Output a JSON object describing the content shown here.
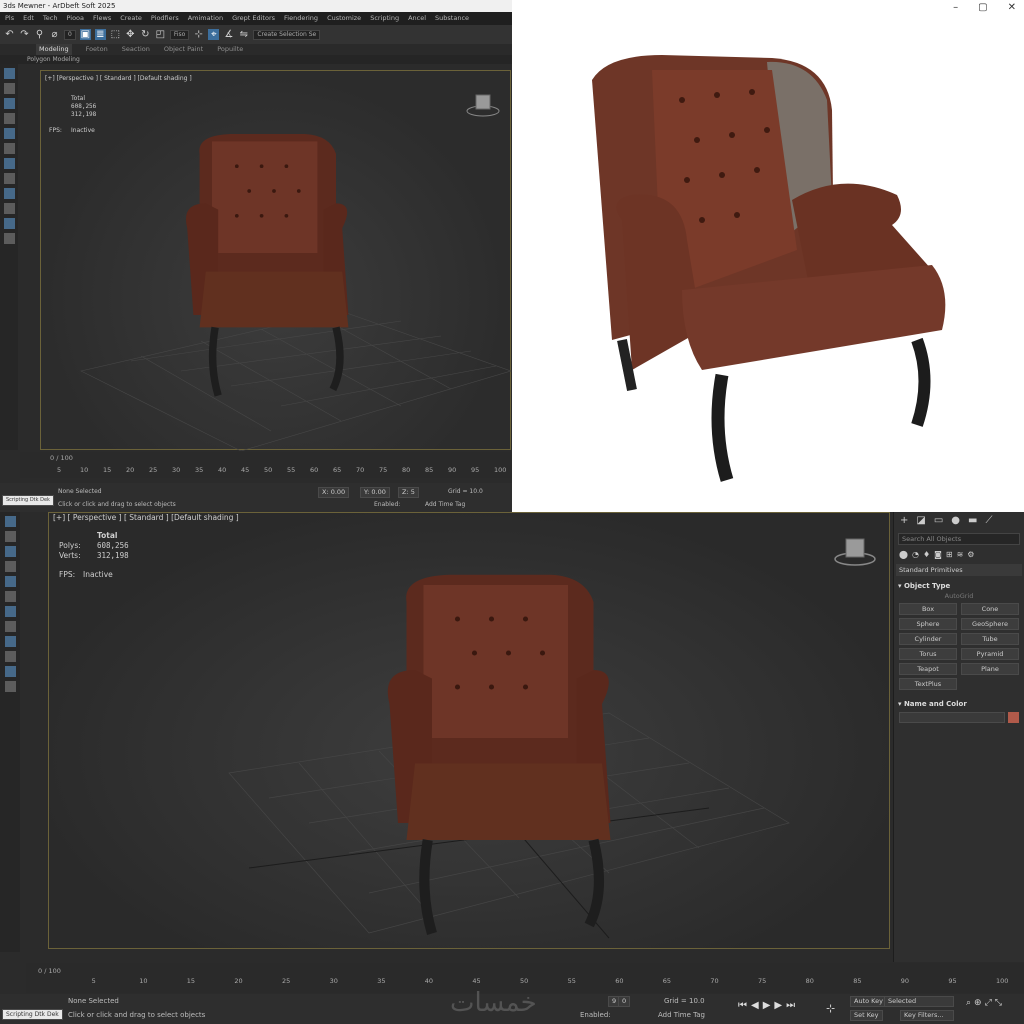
{
  "colors": {
    "viewport_border": "#6b6239",
    "accent": "#3c6e9c",
    "leather": "#6b3224",
    "background": "#2b2b2b"
  },
  "top_app": {
    "title": "3ds Mewner - ArDbeft Soft 2025",
    "menu": [
      "Pls",
      "Edt",
      "Tech",
      "Piooa",
      "Flews",
      "Create",
      "Piodfiers",
      "Amimation",
      "Grept Editors",
      "Fiendering",
      "Customize",
      "Scripting",
      "Ancel",
      "Substance"
    ],
    "toolbar_dropdown_1": "0",
    "toolbar_dropdown_2": "Fiso",
    "toolbar_dropdown_3": "Create Selection Se",
    "ribbon_tabs": [
      "Modeling",
      "Foeton",
      "Seaction",
      "Object Paint",
      "Popuilte"
    ],
    "subtab": "Polygon Modeling",
    "viewport_label": "[+] [Perspective ] [ Standard ] [Default shading ]",
    "stats_total": "Total",
    "stats_polys": "608,256",
    "stats_verts": "312,198",
    "fps_label": "FPS:",
    "fps_value": "Inactive",
    "frame_counter": "0 / 100",
    "ticks": [
      "5",
      "10",
      "15",
      "20",
      "25",
      "30",
      "35",
      "40",
      "45",
      "50",
      "55",
      "60",
      "65",
      "70",
      "75",
      "80",
      "85",
      "90",
      "95",
      "100"
    ],
    "status_left_box": "Scripting Dtk Dek",
    "status_selected": "None Selected",
    "status_hint": "Click or click and drag to select objects",
    "coord_x": "X: 0.00",
    "coord_y": "Y: 0.00",
    "coord_z": "Z: 5",
    "grid": "Grid = 10.0",
    "enabled": "Enabled:",
    "add_time_tag": "Add Time Tag"
  },
  "window_controls": [
    "–",
    "▢",
    "✕"
  ],
  "bottom_app": {
    "viewport_label": "[+] [ Perspective ] [ Standard ] [Default shading ]",
    "stats_total": "Total",
    "stats_polys_label": "Polys:",
    "stats_polys": "608,256",
    "stats_verts_label": "Verts:",
    "stats_verts": "312,198",
    "fps_label": "FPS:",
    "fps_value": "Inactive",
    "frame_counter": "0 / 100",
    "ticks": [
      "5",
      "10",
      "15",
      "20",
      "25",
      "30",
      "35",
      "40",
      "45",
      "50",
      "55",
      "60",
      "65",
      "70",
      "75",
      "80",
      "85",
      "90",
      "95",
      "100"
    ],
    "status_left_box": "Scripting Dtk Dek",
    "status_selected": "None Selected",
    "status_hint": "Click or click and drag to select objects",
    "enabled": "Enabled:",
    "add_time_tag": "Add Time Tag",
    "coord_y": "9",
    "coord_z": "0",
    "grid": "Grid = 10.0",
    "auto_key": "Auto Key",
    "selected_dropdown": "Selected",
    "set_key": "Set Key",
    "key_filters": "Key Filters...",
    "command_panel": {
      "search_placeholder": "Search All Objects",
      "category": "Standard Primitives",
      "object_type_title": "Object Type",
      "autogrid": "AutoGrid",
      "objects": [
        "Box",
        "Cone",
        "Sphere",
        "GeoSphere",
        "Cylinder",
        "Tube",
        "Torus",
        "Pyramid",
        "Teapot",
        "Plane",
        "TextPlus"
      ],
      "name_color_title": "Name and Color"
    },
    "watermark": "خمسات"
  }
}
